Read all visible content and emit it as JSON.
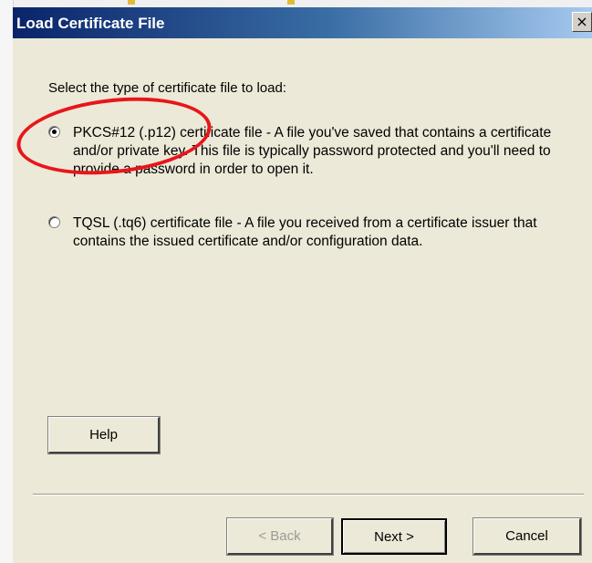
{
  "dialog": {
    "title": "Load Certificate File",
    "close_glyph": "×",
    "prompt": "Select the type of certificate file to load:",
    "options": [
      {
        "label": "PKCS#12 (.p12) certificate file - A file you've saved that contains a certificate and/or private key. This file is typically password protected and you'll need to provide a password in order to open it.",
        "selected": true
      },
      {
        "label": "TQSL (.tq6) certificate file - A file you received from a certificate issuer that contains the issued certificate and/or configuration data.",
        "selected": false
      }
    ],
    "help_label": "Help",
    "back_label": "< Back",
    "next_label": "Next >",
    "cancel_label": "Cancel"
  },
  "annotation": {
    "color": "#e8151b"
  },
  "colors": {
    "dialog_bg": "#ece9d8",
    "titlebar": "#0a246a"
  }
}
